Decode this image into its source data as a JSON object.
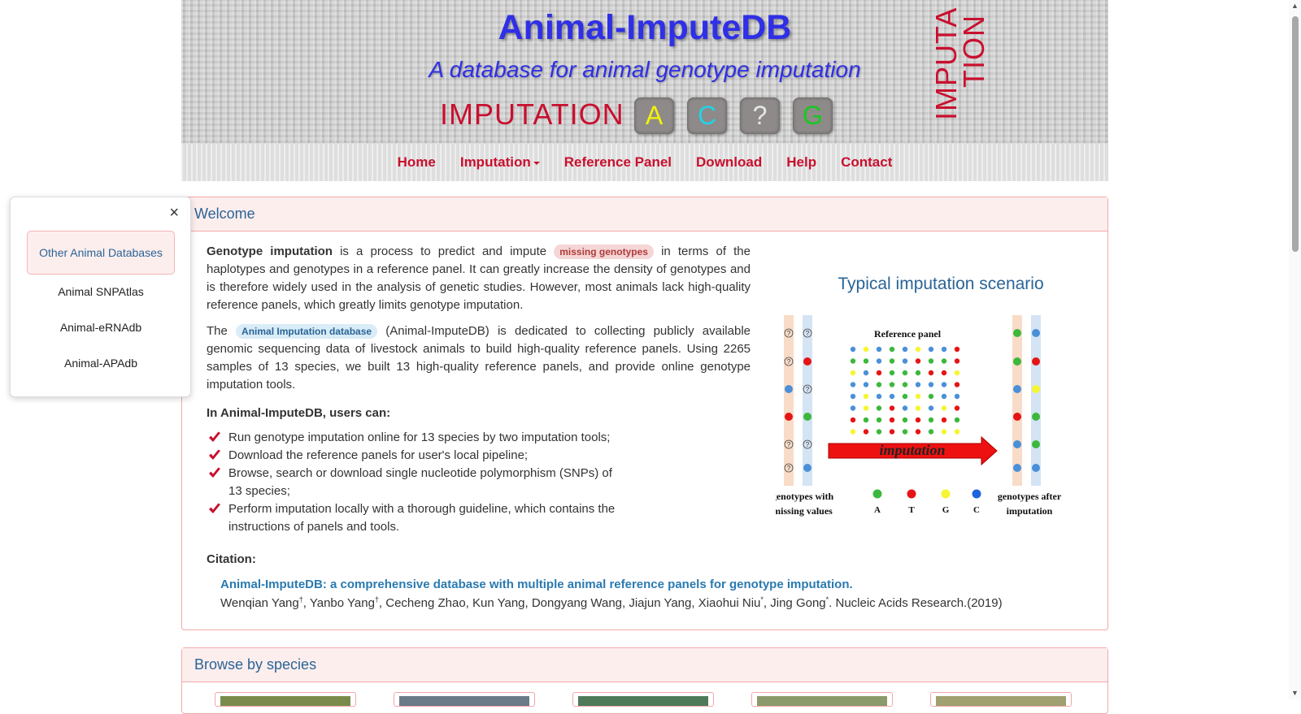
{
  "header": {
    "title": "Animal-ImputeDB",
    "subtitle": "A database for animal genotype imputation",
    "imputation_word": "IMPUTATION",
    "bases": [
      {
        "label": "A",
        "color": "#f2f20a"
      },
      {
        "label": "C",
        "color": "#22d3e6"
      },
      {
        "label": "?",
        "color": "#e6e6e6"
      },
      {
        "label": "G",
        "color": "#19c81e"
      }
    ],
    "vertical_line1": "IMPUTA",
    "vertical_line2": "TION"
  },
  "nav": {
    "home": "Home",
    "imputation": "Imputation",
    "reference_panel": "Reference Panel",
    "download": "Download",
    "help": "Help",
    "contact": "Contact"
  },
  "side": {
    "close": "×",
    "header": "Other Animal Databases",
    "links": [
      "Animal SNPAtlas",
      "Animal-eRNAdb",
      "Animal-APAdb"
    ]
  },
  "welcome": {
    "heading": "Welcome",
    "p1_bold": "Genotype imputation",
    "p1_a": " is a process to predict and impute ",
    "p1_tag": "missing genotypes",
    "p1_b": " in terms of the haplotypes and genotypes in a reference panel. It can greatly increase the density of genotypes and is therefore widely used in the analysis of genetic studies. However, most animals lack high-quality reference panels, which greatly limits genotype imputation.",
    "p2_a": "The ",
    "p2_tag": "Animal Imputation database",
    "p2_b": " (Animal-ImputeDB) is dedicated to collecting publicly available genomic sequencing data of livestock animals to build high-quality reference panels. Using 2265 samples of 13 species, we built 13 high-quality reference panels, and provide online genotype imputation tools.",
    "users_heading": "In Animal-ImputeDB, users can:",
    "features": [
      "Run genotype imputation online for 13 species by two imputation tools;",
      "Download the reference panels for user's local pipeline;",
      "Browse, search or download single nucleotide polymorphism (SNPs) of 13 species;",
      "Perform imputation locally with a thorough guideline, which contains the instructions of panels and tools."
    ],
    "citation_heading": "Citation:",
    "citation_title": "Animal-ImputeDB: a comprehensive database with multiple animal reference panels for genotype imputation.",
    "citation_authors_a": "Wenqian Yang",
    "citation_authors_b": ", Yanbo Yang",
    "citation_authors_c": ", Cecheng Zhao, Kun Yang, Dongyang Wang, Jiajun Yang, Xiaohui Niu",
    "citation_authors_d": ", Jing Gong",
    "citation_authors_e": ". Nucleic Acids Research.(2019)",
    "sup_dagger": "†",
    "sup_star": "*"
  },
  "scenario": {
    "title": "Typical imputation scenario",
    "reference_panel": "Reference panel",
    "arrow_label": "imputation",
    "left_caption_1": "genotypes with",
    "left_caption_2": "missing values",
    "right_caption_1": "genotypes after",
    "right_caption_2": "imputation",
    "legend": [
      {
        "label": "A",
        "color": "#3cb83c"
      },
      {
        "label": "T",
        "color": "#e61414"
      },
      {
        "label": "G",
        "color": "#f5f532"
      },
      {
        "label": "C",
        "color": "#1e64dc"
      }
    ]
  },
  "browse": {
    "heading": "Browse by species"
  }
}
